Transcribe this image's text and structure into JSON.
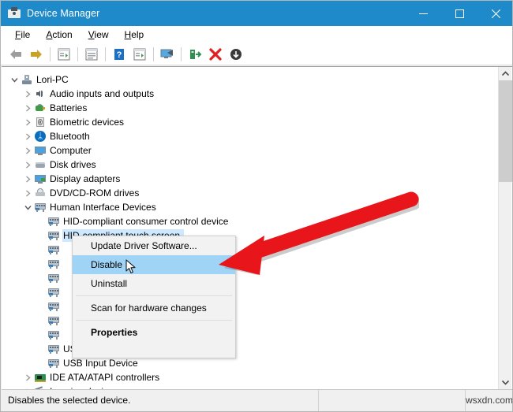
{
  "window": {
    "title": "Device Manager",
    "title_icon": "device-manager-icon",
    "titlebar_color": "#1f8ac9",
    "controls": [
      {
        "name": "minimize",
        "glyph": "minimize-icon"
      },
      {
        "name": "maximize",
        "glyph": "maximize-icon"
      },
      {
        "name": "close",
        "glyph": "close-icon"
      }
    ]
  },
  "menubar": {
    "items": [
      {
        "label": "File",
        "accel": "F"
      },
      {
        "label": "Action",
        "accel": "A"
      },
      {
        "label": "View",
        "accel": "V"
      },
      {
        "label": "Help",
        "accel": "H"
      }
    ]
  },
  "toolbar": {
    "buttons": [
      {
        "name": "back-icon"
      },
      {
        "name": "forward-icon"
      },
      {
        "name": "show-hide-console-tree-icon"
      },
      {
        "name": "properties-icon"
      },
      {
        "name": "help-icon"
      },
      {
        "name": "show-hide-action-pane-icon"
      },
      {
        "name": "scan-for-hardware-changes-icon"
      },
      {
        "name": "update-driver-software-icon"
      },
      {
        "name": "uninstall-device-icon"
      },
      {
        "name": "disable-device-icon"
      }
    ]
  },
  "tree": {
    "rows": [
      {
        "label": "Lori-PC",
        "indent": 0,
        "twisty": "expanded",
        "icon": "computer-root-icon",
        "selected": false
      },
      {
        "label": "Audio inputs and outputs",
        "indent": 1,
        "twisty": "collapsed",
        "icon": "speaker-icon",
        "selected": false
      },
      {
        "label": "Batteries",
        "indent": 1,
        "twisty": "collapsed",
        "icon": "battery-icon",
        "selected": false
      },
      {
        "label": "Biometric devices",
        "indent": 1,
        "twisty": "collapsed",
        "icon": "fingerprint-icon",
        "selected": false
      },
      {
        "label": "Bluetooth",
        "indent": 1,
        "twisty": "collapsed",
        "icon": "bluetooth-icon",
        "selected": false
      },
      {
        "label": "Computer",
        "indent": 1,
        "twisty": "collapsed",
        "icon": "monitor-icon",
        "selected": false
      },
      {
        "label": "Disk drives",
        "indent": 1,
        "twisty": "collapsed",
        "icon": "disk-drive-icon",
        "selected": false
      },
      {
        "label": "Display adapters",
        "indent": 1,
        "twisty": "collapsed",
        "icon": "display-adapter-icon",
        "selected": false
      },
      {
        "label": "DVD/CD-ROM drives",
        "indent": 1,
        "twisty": "collapsed",
        "icon": "dvd-drive-icon",
        "selected": false
      },
      {
        "label": "Human Interface Devices",
        "indent": 1,
        "twisty": "expanded",
        "icon": "hid-icon",
        "selected": false
      },
      {
        "label": "HID-compliant consumer control device",
        "indent": 2,
        "twisty": "none",
        "icon": "hid-icon",
        "selected": false
      },
      {
        "label": "HID-compliant touch screen",
        "indent": 2,
        "twisty": "none",
        "icon": "hid-icon",
        "selected": true
      },
      {
        "label": "",
        "indent": 2,
        "twisty": "none",
        "icon": "hid-icon",
        "selected": false
      },
      {
        "label": "",
        "indent": 2,
        "twisty": "none",
        "icon": "hid-icon",
        "selected": false
      },
      {
        "label": "",
        "indent": 2,
        "twisty": "none",
        "icon": "hid-icon",
        "selected": false
      },
      {
        "label": "",
        "indent": 2,
        "twisty": "none",
        "icon": "hid-icon",
        "selected": false
      },
      {
        "label": "",
        "indent": 2,
        "twisty": "none",
        "icon": "hid-icon",
        "selected": false
      },
      {
        "label": "",
        "indent": 2,
        "twisty": "none",
        "icon": "hid-icon",
        "selected": false
      },
      {
        "label": "",
        "indent": 2,
        "twisty": "none",
        "icon": "hid-icon",
        "selected": false
      },
      {
        "label": "USB Input Device",
        "indent": 2,
        "twisty": "none",
        "icon": "hid-icon",
        "selected": false
      },
      {
        "label": "USB Input Device",
        "indent": 2,
        "twisty": "none",
        "icon": "hid-icon",
        "selected": false
      },
      {
        "label": "IDE ATA/ATAPI controllers",
        "indent": 1,
        "twisty": "collapsed",
        "icon": "ide-controller-icon",
        "selected": false
      },
      {
        "label": "Imaging devices",
        "indent": 1,
        "twisty": "collapsed",
        "icon": "imaging-device-icon",
        "selected": false
      }
    ],
    "selection_color": "#cde8ff"
  },
  "context_menu": {
    "items": [
      {
        "label": "Update Driver Software...",
        "highlighted": false,
        "bold": false,
        "separator_after": false
      },
      {
        "label": "Disable",
        "highlighted": true,
        "bold": false,
        "separator_after": false
      },
      {
        "label": "Uninstall",
        "highlighted": false,
        "bold": false,
        "separator_after": true
      },
      {
        "label": "Scan for hardware changes",
        "highlighted": false,
        "bold": false,
        "separator_after": true
      },
      {
        "label": "Properties",
        "highlighted": false,
        "bold": true,
        "separator_after": false
      }
    ],
    "highlight_color": "#9fd4f7"
  },
  "annotation": {
    "arrow_color": "#e8151b",
    "name": "red-pointer-arrow"
  },
  "scrollbar": {
    "up_arrow": "chevron-up-icon",
    "down_arrow": "chevron-down-icon",
    "thumb_color": "#cdcdcd"
  },
  "statusbar": {
    "text": "Disables the selected device.",
    "middle": "",
    "watermark": "wsxdn.com"
  }
}
